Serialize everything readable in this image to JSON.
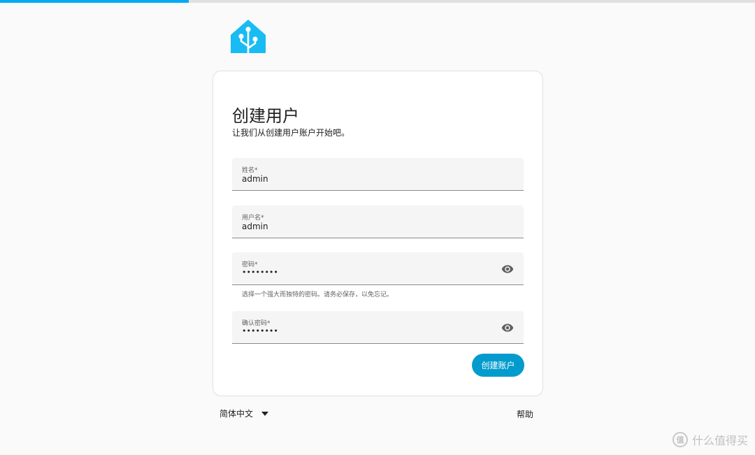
{
  "progress": {
    "value": 0.25,
    "color": "#03a9f4"
  },
  "logo": {
    "icon": "home-assistant-logo",
    "color": "#18bcf2"
  },
  "form": {
    "title": "创建用户",
    "subtitle": "让我们从创建用户账户开始吧。",
    "fields": [
      {
        "label": "姓名*",
        "value": "admin",
        "type": "text"
      },
      {
        "label": "用户名*",
        "value": "admin",
        "type": "text"
      },
      {
        "label": "密码*",
        "value": "••••••••",
        "type": "password",
        "icon": "eye-icon"
      },
      {
        "label": "确认密码*",
        "value": "••••••••",
        "type": "password",
        "icon": "eye-icon"
      }
    ],
    "password_helper": "选择一个强大而独特的密码。请务必保存，以免忘记。",
    "submit_label": "创建账户",
    "accent": "#039bcd"
  },
  "footer": {
    "language": "简体中文",
    "language_icon": "caret-down-icon",
    "help_label": "帮助"
  },
  "watermark": {
    "badge": "值",
    "text": "什么值得买"
  }
}
